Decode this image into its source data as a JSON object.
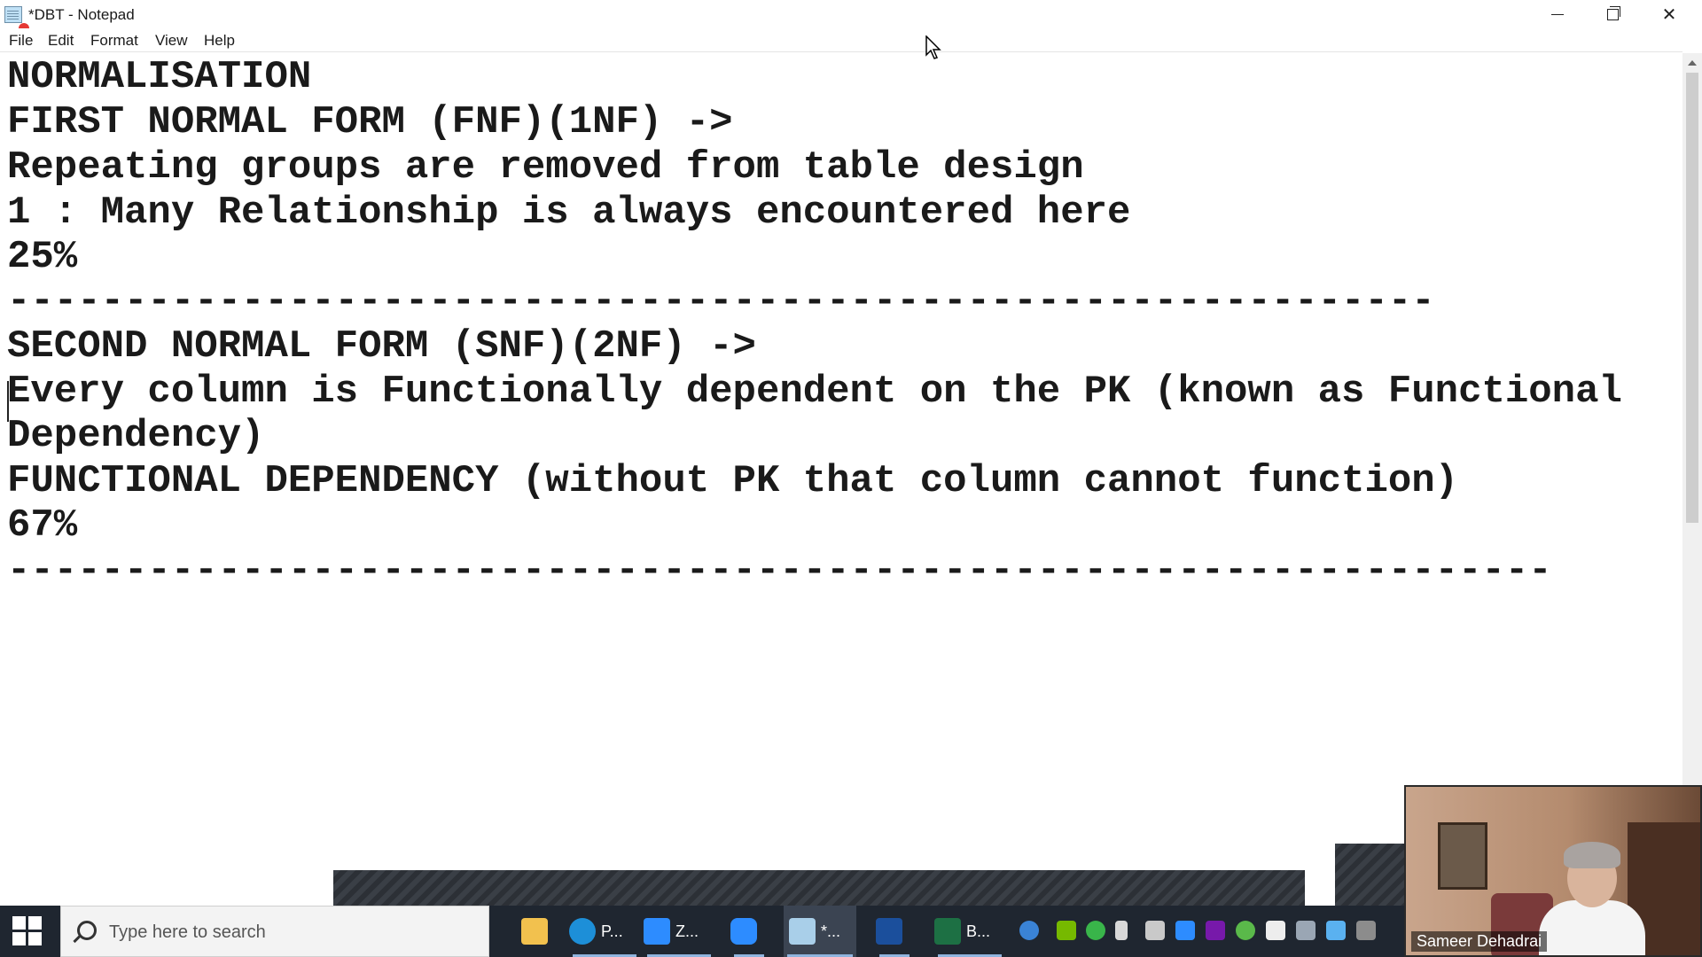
{
  "window": {
    "title": "*DBT - Notepad"
  },
  "menu": {
    "file": "File",
    "edit": "Edit",
    "format": "Format",
    "view": "View",
    "help": "Help"
  },
  "editor": {
    "lines": [
      "NORMALISATION",
      "FIRST NORMAL FORM (FNF)(1NF) ->",
      "Repeating groups are removed from table design",
      "1 : Many Relationship is always encountered here",
      "25%",
      "-------------------------------------------------------------",
      "SECOND NORMAL FORM (SNF)(2NF) ->",
      "Every column is Functionally dependent on the PK (known as Functional",
      "Dependency)",
      "FUNCTIONAL DEPENDENCY (without PK that column cannot function)",
      "67%",
      "------------------------------------------------------------------"
    ]
  },
  "taskbar": {
    "search_placeholder": "Type here to search",
    "items": [
      {
        "icon": "file-explorer-icon",
        "label": ""
      },
      {
        "icon": "edge-icon",
        "label": "P..."
      },
      {
        "icon": "zoom-icon",
        "label": "Z..."
      },
      {
        "icon": "zoom-meeting-icon",
        "label": ""
      },
      {
        "icon": "notepad-icon",
        "label": "*..."
      },
      {
        "icon": "whiteboard-icon",
        "label": ""
      },
      {
        "icon": "excel-icon",
        "label": "B..."
      }
    ]
  },
  "webcam": {
    "name": "Sameer Dehadrai"
  },
  "colors": {
    "taskbar": "#1f2630",
    "text": "#1a1a1a",
    "accent": "#8fb4de"
  }
}
